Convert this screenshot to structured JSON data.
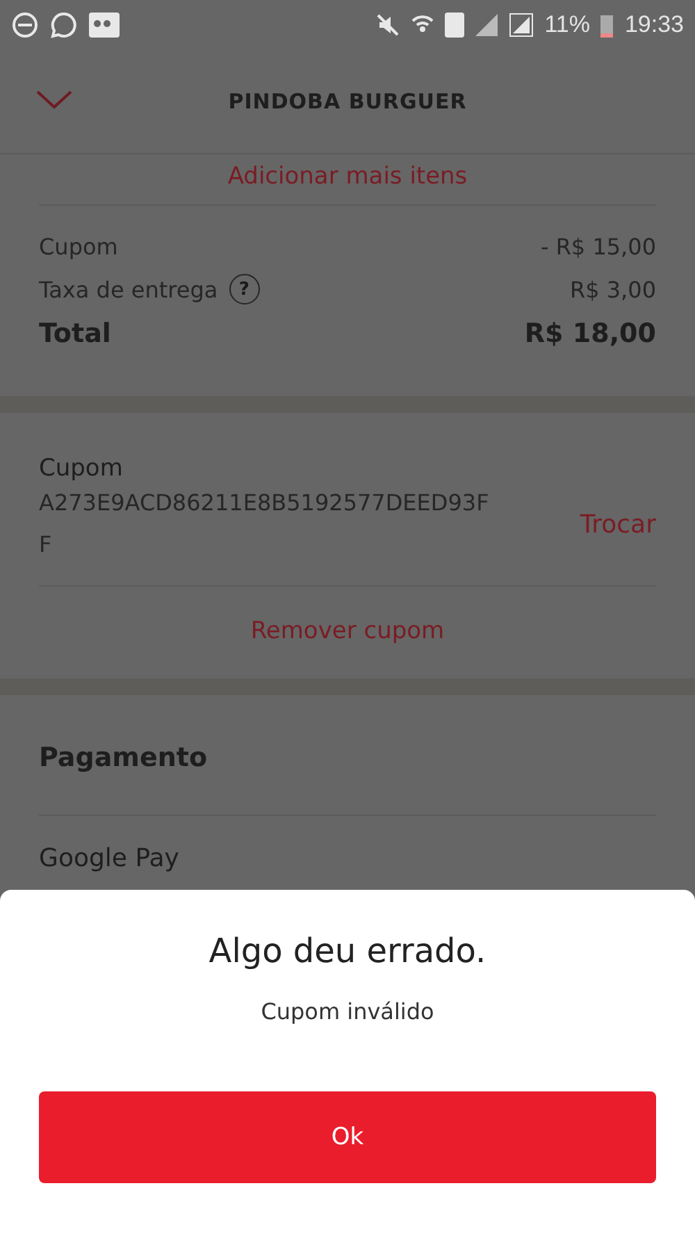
{
  "status_bar": {
    "battery": "11%",
    "time": "19:33"
  },
  "header": {
    "title": "PINDOBA BURGUER"
  },
  "add_items": "Adicionar mais itens",
  "summary": {
    "rows": [
      {
        "label": "Cupom",
        "value": "- R$ 15,00"
      },
      {
        "label": "Taxa de entrega",
        "value": "R$ 3,00",
        "help": "?"
      }
    ],
    "total_label": "Total",
    "total_value": "R$ 18,00"
  },
  "coupon": {
    "title": "Cupom",
    "code_lines": [
      "A273E9ACD86211E8B5192577DEED93F",
      "F"
    ],
    "change": "Trocar",
    "remove": "Remover cupom"
  },
  "payment": {
    "title": "Pagamento",
    "method": "Google Pay"
  },
  "dialog": {
    "title": "Algo deu errado.",
    "message": "Cupom inválido",
    "button": "Ok"
  }
}
